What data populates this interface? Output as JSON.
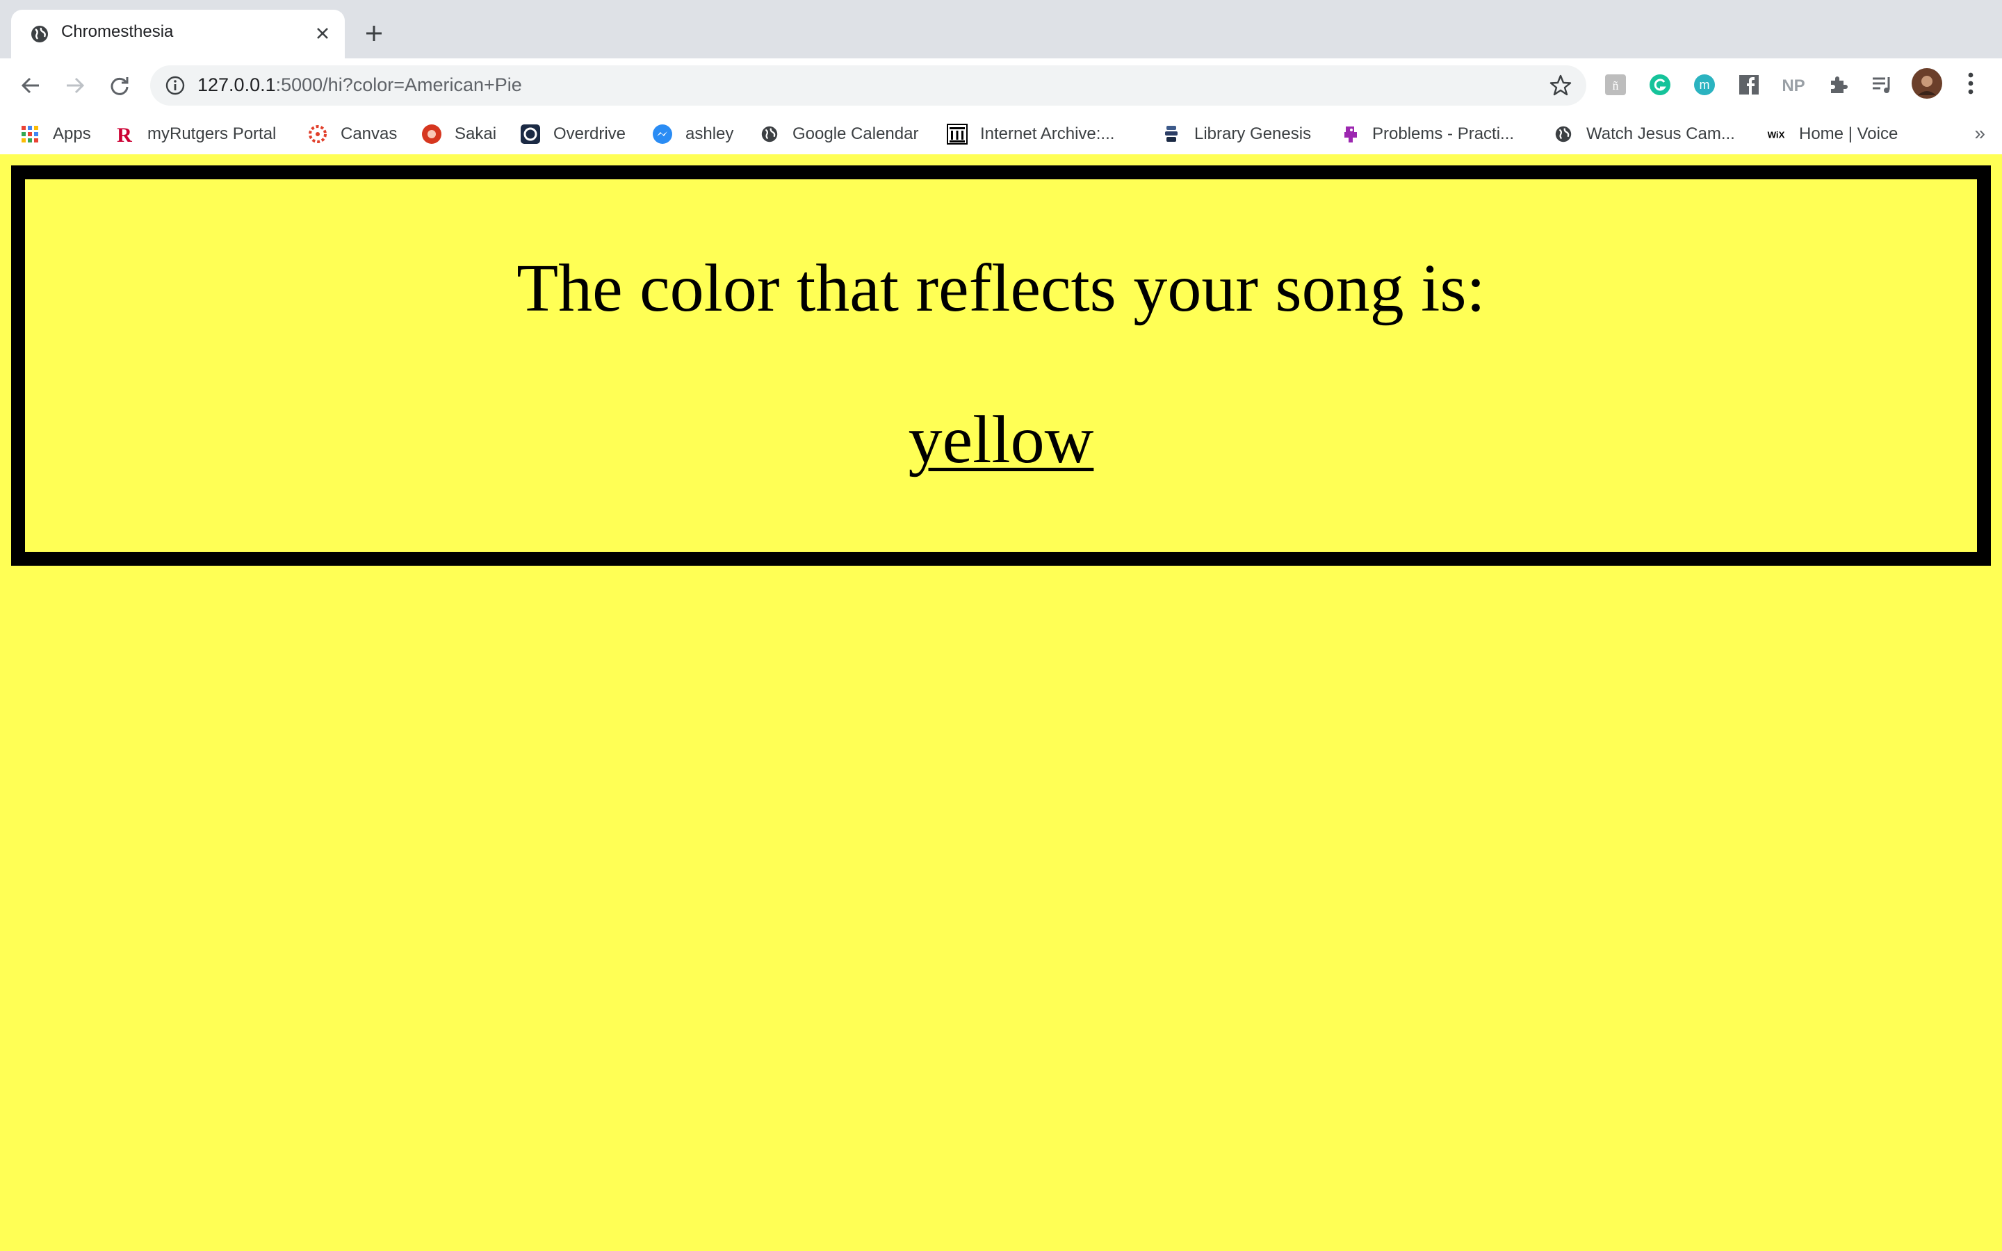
{
  "browser": {
    "tab": {
      "title": "Chromesthesia",
      "favicon": "globe-icon"
    },
    "address_bar": {
      "host": "127.0.0.1",
      "rest": ":5000/hi?color=American+Pie"
    },
    "extensions": [
      {
        "name": "handwriting-extension-icon"
      },
      {
        "name": "grammarly-icon",
        "color": "#15c39a"
      },
      {
        "name": "m-extension-icon",
        "color": "#2bb3c0"
      },
      {
        "name": "facebook-extension-icon"
      },
      {
        "name": "np-extension-icon",
        "text": "NP"
      },
      {
        "name": "extensions-puzzle-icon"
      },
      {
        "name": "reading-list-icon"
      }
    ],
    "bookmarks": [
      {
        "label": "Apps",
        "icon": "apps-grid-icon"
      },
      {
        "label": "myRutgers Portal",
        "icon": "rutgers-icon"
      },
      {
        "label": "Canvas",
        "icon": "canvas-icon"
      },
      {
        "label": "Sakai",
        "icon": "sakai-icon"
      },
      {
        "label": "Overdrive",
        "icon": "overdrive-icon"
      },
      {
        "label": "ashley",
        "icon": "messenger-icon"
      },
      {
        "label": "Google Calendar",
        "icon": "globe-icon"
      },
      {
        "label": "Internet Archive:...",
        "icon": "archive-icon"
      },
      {
        "label": "Library Genesis",
        "icon": "libgen-icon"
      },
      {
        "label": "Problems - Practi...",
        "icon": "problems-icon"
      },
      {
        "label": "Watch Jesus Cam...",
        "icon": "globe-icon"
      },
      {
        "label": "Home | Voice",
        "icon": "wix-icon"
      }
    ],
    "more_bookmarks": "»"
  },
  "page": {
    "background_color": "#ffff55",
    "heading": "The color that reflects your song is:",
    "color_result": "yellow"
  }
}
